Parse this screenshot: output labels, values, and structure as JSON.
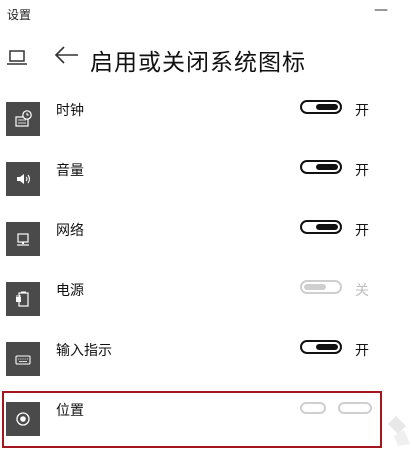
{
  "window": {
    "app_title": "设置",
    "minimize_glyph": "—"
  },
  "header": {
    "title": "启用或关闭系统图标",
    "back_icon": "arrow-left-icon",
    "device_icon": "laptop-icon"
  },
  "items": [
    {
      "label": "时钟",
      "icon": "clock-icon",
      "on": true,
      "state_label": "开"
    },
    {
      "label": "音量",
      "icon": "speaker-icon",
      "on": true,
      "state_label": "开"
    },
    {
      "label": "网络",
      "icon": "network-icon",
      "on": true,
      "state_label": "开"
    },
    {
      "label": "电源",
      "icon": "battery-plug-icon",
      "on": false,
      "state_label": "关"
    },
    {
      "label": "输入指示",
      "icon": "keyboard-icon",
      "on": true,
      "state_label": "开"
    },
    {
      "label": "位置",
      "icon": "location-icon",
      "on": false,
      "state_label": ""
    }
  ],
  "colors": {
    "tile": "#4a4a4a",
    "highlight": "#a4161d",
    "toggle_on": "#111111",
    "toggle_off": "#cfcfcf"
  }
}
